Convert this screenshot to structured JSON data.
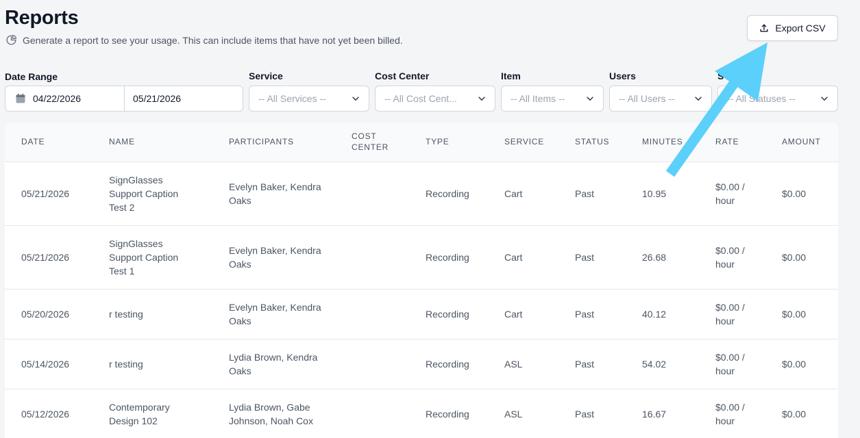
{
  "header": {
    "title": "Reports",
    "subtitle": "Generate a report to see your usage. This can include items that have not yet been billed.",
    "export_label": "Export CSV"
  },
  "filters": {
    "date_range": {
      "label": "Date Range",
      "start": "04/22/2026",
      "end": "05/21/2026"
    },
    "service": {
      "label": "Service",
      "value": "-- All Services --"
    },
    "cost_center": {
      "label": "Cost Center",
      "value": "-- All Cost Cent..."
    },
    "item": {
      "label": "Item",
      "value": "-- All Items --"
    },
    "users": {
      "label": "Users",
      "value": "-- All Users --"
    },
    "status": {
      "label": "S",
      "value": "-- All Statuses --"
    }
  },
  "table": {
    "columns": [
      "DATE",
      "NAME",
      "PARTICIPANTS",
      "COST CENTER",
      "TYPE",
      "SERVICE",
      "STATUS",
      "MINUTES",
      "RATE",
      "AMOUNT"
    ],
    "rows": [
      {
        "date": "05/21/2026",
        "name": "SignGlasses Support Caption Test 2",
        "participants": "Evelyn Baker, Kendra Oaks",
        "cost_center": "",
        "type": "Recording",
        "service": "Cart",
        "status": "Past",
        "minutes": "10.95",
        "rate": "$0.00 / hour",
        "amount": "$0.00"
      },
      {
        "date": "05/21/2026",
        "name": "SignGlasses Support Caption Test 1",
        "participants": "Evelyn Baker, Kendra Oaks",
        "cost_center": "",
        "type": "Recording",
        "service": "Cart",
        "status": "Past",
        "minutes": "26.68",
        "rate": "$0.00 / hour",
        "amount": "$0.00"
      },
      {
        "date": "05/20/2026",
        "name": "r testing",
        "participants": "Evelyn Baker, Kendra Oaks",
        "cost_center": "",
        "type": "Recording",
        "service": "Cart",
        "status": "Past",
        "minutes": "40.12",
        "rate": "$0.00 / hour",
        "amount": "$0.00"
      },
      {
        "date": "05/14/2026",
        "name": "r testing",
        "participants": "Lydia Brown, Kendra Oaks",
        "cost_center": "",
        "type": "Recording",
        "service": "ASL",
        "status": "Past",
        "minutes": "54.02",
        "rate": "$0.00 / hour",
        "amount": "$0.00"
      },
      {
        "date": "05/12/2026",
        "name": "Contemporary Design 102",
        "participants": "Lydia Brown, Gabe Johnson, Noah Cox",
        "cost_center": "",
        "type": "Recording",
        "service": "ASL",
        "status": "Past",
        "minutes": "16.67",
        "rate": "$0.00 / hour",
        "amount": "$0.00"
      }
    ]
  },
  "colors": {
    "background": "#f4f5f7",
    "annotation_arrow": "#5ad0fa"
  },
  "icons": {
    "subtitle": "pie-chart-icon",
    "export": "upload-icon",
    "date": "calendar-icon",
    "select": "chevron-down-icon"
  }
}
